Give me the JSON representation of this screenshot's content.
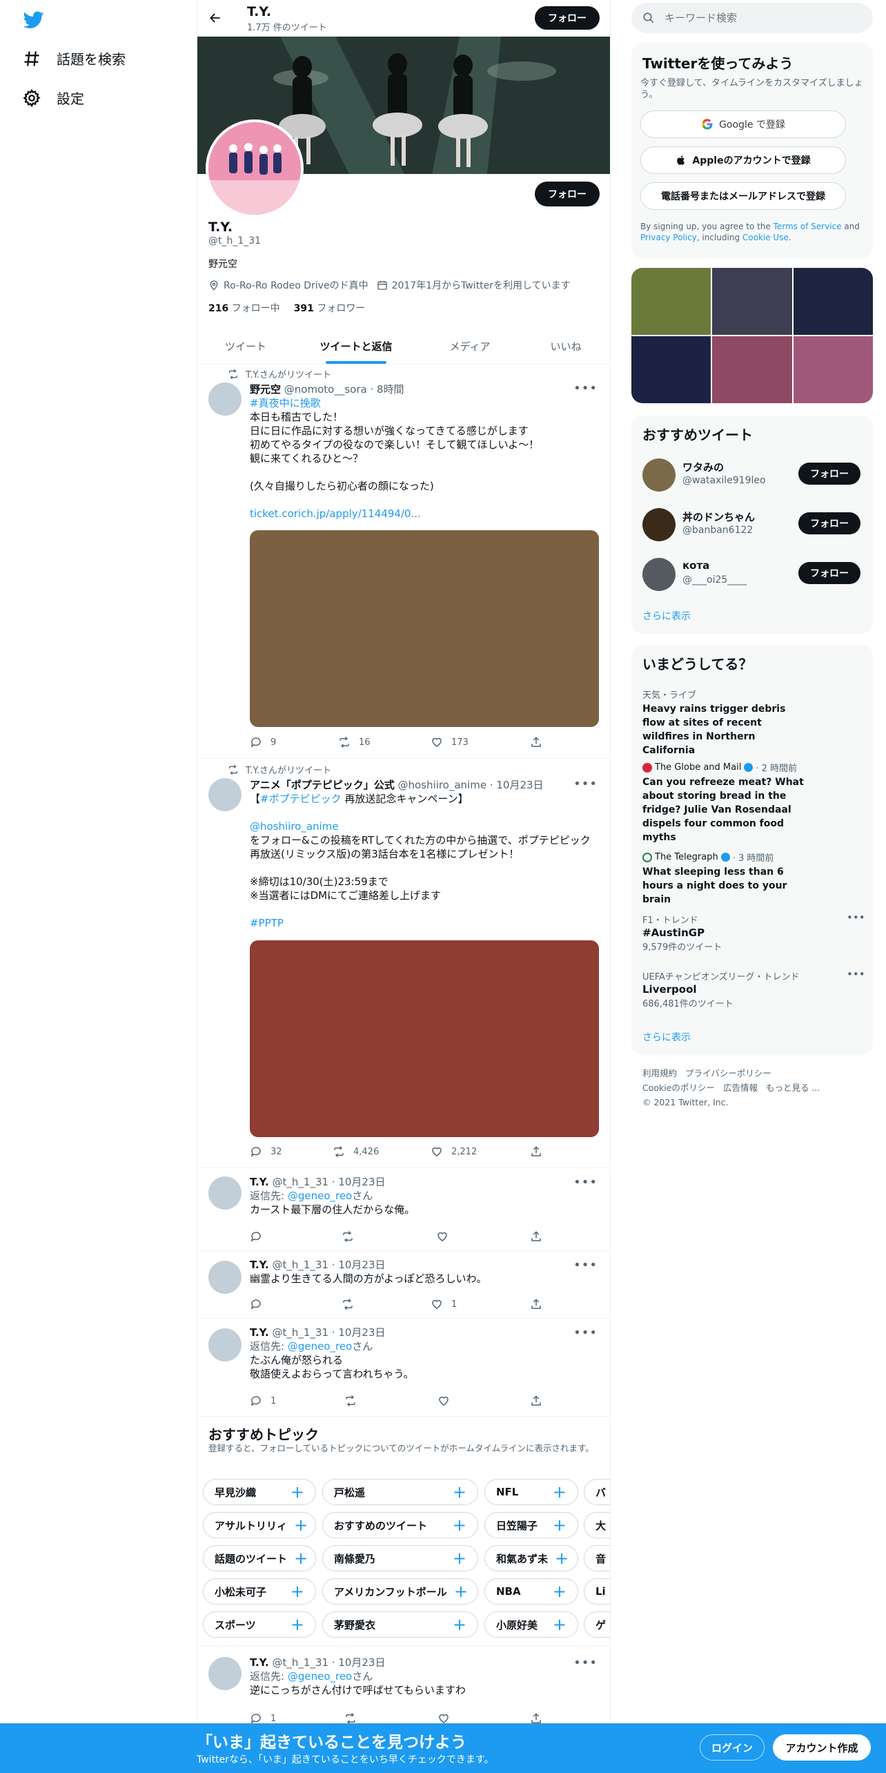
{
  "leftnav": {
    "items": [
      {
        "label": "話題を検索",
        "icon": "hash-icon"
      },
      {
        "label": "設定",
        "icon": "gear-icon"
      }
    ]
  },
  "header": {
    "title": "T.Y.",
    "subtitle": "1.7万 件のツイート",
    "follow_label": "フォロー"
  },
  "profile": {
    "name": "T.Y.",
    "handle": "@t_h_1_31",
    "bio": "野元空",
    "location": "Ro-Ro-Ro Rodeo Driveのド真中",
    "joined": "2017年1月からTwitterを利用しています",
    "following_count": "216",
    "following_label": "フォロー中",
    "followers_count": "391",
    "followers_label": "フォロワー",
    "follow_label": "フォロー"
  },
  "tabs": [
    {
      "label": "ツイート",
      "active": false
    },
    {
      "label": "ツイートと返信",
      "active": true
    },
    {
      "label": "メディア",
      "active": false
    },
    {
      "label": "いいね",
      "active": false
    }
  ],
  "tweets": [
    {
      "retweet_label": "T.Y.さんがリツイート",
      "name": "野元空",
      "meta": "@nomoto__sora · 8時間",
      "hashtag": "#真夜中に挽歌",
      "lines": [
        "本日も稽古でした！",
        "日に日に作品に対する想いが強くなってきてる感じがします",
        "初めてやるタイプの役なので楽しい！そして観てほしいよ〜！",
        "観に来てくれるひと〜？",
        "",
        "(久々自撮りしたら初心者の顔になった)"
      ],
      "link": "ticket.corich.jp/apply/114494/0...",
      "image_color": "#7b6042",
      "reply": "9",
      "retweet": "16",
      "like": "173"
    },
    {
      "retweet_label": "T.Y.さんがリツイート",
      "name": "アニメ「ポプテピピック」公式",
      "meta": "@hoshiiro_anime · 10月23日",
      "line1_prefix": "【",
      "line1_tag": "#ポプテピピック",
      "line1_suffix": " 再放送記念キャンペーン】",
      "mention": "@hoshiiro_anime",
      "lines": [
        "をフォロー&この投稿をRTしてくれた方の中から抽選で、ポプテピピック",
        "再放送(リミックス版)の第3話台本を1名様にプレゼント！",
        "",
        "※締切は10/30(土)23:59まで",
        "※当選者にはDMにてご連絡差し上げます"
      ],
      "hashtag2": "#PPTP",
      "image_color": "#8f3c33",
      "reply": "32",
      "retweet": "4,426",
      "like": "2,212"
    },
    {
      "name": "T.Y.",
      "meta": "@t_h_1_31 · 10月23日",
      "reply_to_prefix": "返信先: ",
      "reply_to": "@geneo_reo",
      "reply_to_suffix": "さん",
      "lines": [
        "カースト最下層の住人だからな俺。"
      ],
      "reply": "",
      "retweet": "",
      "like": ""
    },
    {
      "name": "T.Y.",
      "meta": "@t_h_1_31 · 10月23日",
      "lines": [
        "幽霊より生きてる人間の方がよっぽど恐ろしいわ。"
      ],
      "reply": "",
      "retweet": "",
      "like": "1"
    },
    {
      "name": "T.Y.",
      "meta": "@t_h_1_31 · 10月23日",
      "reply_to_prefix": "返信先: ",
      "reply_to": "@geneo_reo",
      "reply_to_suffix": "さん",
      "lines": [
        "たぶん俺が怒られる",
        "敬語使えよおらって言われちゃう。"
      ],
      "reply": "1",
      "retweet": "",
      "like": ""
    },
    {
      "name": "T.Y.",
      "meta": "@t_h_1_31 · 10月23日",
      "reply_to_prefix": "返信先: ",
      "reply_to": "@geneo_reo",
      "reply_to_suffix": "さん",
      "lines": [
        "逆にこっちがさん付けで呼ばせてもらいますわ"
      ],
      "reply": "1",
      "retweet": "",
      "like": ""
    }
  ],
  "topics": {
    "title": "おすすめトピック",
    "subtitle": "登録すると、フォローしているトピックについてのツイートがホームタイムラインに表示されます。",
    "rows": [
      [
        "早見沙織",
        "戸松遥",
        "NFL",
        "バ"
      ],
      [
        "アサルトリリィ",
        "おすすめのツイート",
        "日笠陽子",
        "大"
      ],
      [
        "話題のツイート",
        "南條愛乃",
        "和氣あず未",
        "音"
      ],
      [
        "小松未可子",
        "アメリカンフットボール",
        "NBA",
        "Li"
      ],
      [
        "スポーツ",
        "茅野愛衣",
        "小原好美",
        "ゲ"
      ]
    ]
  },
  "search": {
    "placeholder": "キーワード検索"
  },
  "signup": {
    "title": "Twitterを使ってみよう",
    "subtitle": "今すぐ登録して、タイムラインをカスタマイズしましょう。",
    "google": "Google で登録",
    "apple": "Appleのアカウントで登録",
    "phone": "電話番号またはメールアドレスで登録",
    "terms_prefix": "By signing up, you agree to the ",
    "terms_link": "Terms of Service",
    "terms_mid": " and ",
    "privacy_link": "Privacy Policy",
    "terms_mid2": ", including ",
    "cookie_link": "Cookie Use",
    "terms_end": "."
  },
  "media_grid": [
    "#6b7a3a",
    "#3e3e52",
    "#1e2340",
    "#1c2244",
    "#8e4a62",
    "#a0587a"
  ],
  "who_to_follow": {
    "title": "おすすめツイート",
    "users": [
      {
        "name": "ワタみの",
        "handle": "@wataxile919leo",
        "follow": "フォロー",
        "color": "#7a6a4a"
      },
      {
        "name": "丼のドンちゃん",
        "handle": "@banban6122",
        "follow": "フォロー",
        "color": "#3a2a1a"
      },
      {
        "name": "кота",
        "handle": "@___oi25____",
        "follow": "フォロー",
        "color": "#555a60"
      }
    ],
    "more": "さらに表示"
  },
  "trends": {
    "title": "いまどうしてる？",
    "items": [
      {
        "meta": "天気・ライブ",
        "title": "Heavy rains trigger debris flow at sites of recent wildfires in Northern California"
      },
      {
        "source": "The Globe and Mail",
        "time": "· 2 時間前",
        "title": "Can you refreeze meat? What about storing bread in the fridge? Julie Van Rosendaal dispels four common food myths"
      },
      {
        "source": "The Telegraph",
        "time": "· 3 時間前",
        "title": "What sleeping less than 6 hours a night does to your brain"
      },
      {
        "meta": "F1・トレンド",
        "title": "#AustinGP",
        "count": "9,579件のツイート"
      },
      {
        "meta": "UEFAチャンピオンズリーグ・トレンド",
        "title": "Liverpool",
        "count": "686,481件のツイート"
      }
    ],
    "more": "さらに表示"
  },
  "footer": {
    "line1": [
      "利用規約",
      "プライバシーポリシー"
    ],
    "line2": [
      "Cookieのポリシー",
      "広告情報",
      "もっと見る ..."
    ],
    "copyright": "© 2021 Twitter, Inc."
  },
  "bottombar": {
    "title": "「いま」起きていることを見つけよう",
    "subtitle": "Twitterなら、「いま」起きていることをいち早くチェックできます。",
    "login": "ログイン",
    "signup": "アカウント作成"
  }
}
